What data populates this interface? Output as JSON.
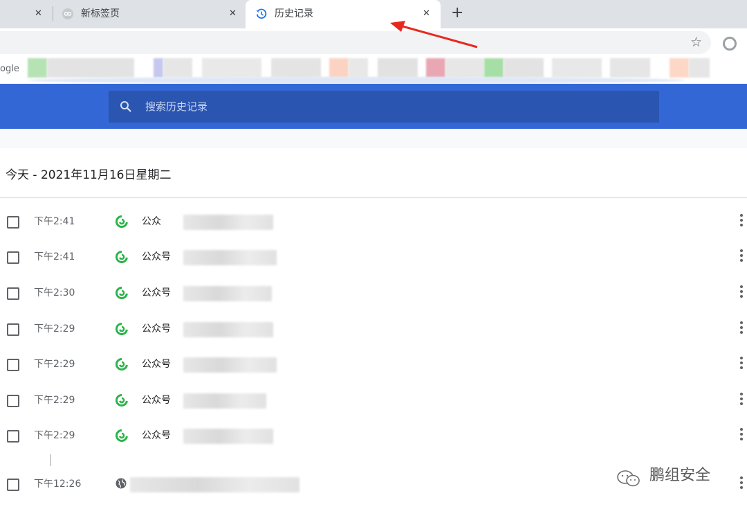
{
  "tabs": [
    {
      "title": "",
      "close": "✕"
    },
    {
      "title": "新标签页",
      "close": "✕"
    },
    {
      "title": "历史记录",
      "close": "✕",
      "active": true
    }
  ],
  "new_tab_symbol": "+",
  "bookmarks_bar": {
    "first_label": "ogle"
  },
  "history": {
    "search_placeholder": "搜索历史记录",
    "date_heading": "今天 - 2021年11月16日星期二",
    "entries": [
      {
        "time": "下午2:41",
        "title": "公众",
        "icon": "wechat-icon"
      },
      {
        "time": "下午2:41",
        "title": "公众号",
        "icon": "wechat-icon"
      },
      {
        "time": "下午2:30",
        "title": "公众号",
        "icon": "wechat-icon"
      },
      {
        "time": "下午2:29",
        "title": "公众号",
        "icon": "wechat-icon"
      },
      {
        "time": "下午2:29",
        "title": "公众号",
        "icon": "wechat-icon"
      },
      {
        "time": "下午2:29",
        "title": "公众号",
        "icon": "wechat-icon"
      },
      {
        "time": "下午2:29",
        "title": "公众号",
        "icon": "wechat-icon"
      },
      {
        "time": "下午12:26",
        "title": "",
        "icon": "globe-icon"
      }
    ]
  },
  "watermark": "鹏组安全",
  "colors": {
    "header_blue": "#3367d6",
    "search_blue": "#2a55b1",
    "wechat_green": "#2bb44a",
    "arrow_red": "#e8281f"
  }
}
